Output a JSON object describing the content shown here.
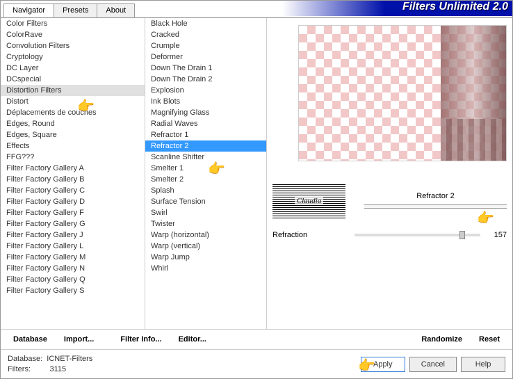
{
  "header": {
    "title": "Filters Unlimited 2.0"
  },
  "tabs": [
    {
      "label": "Navigator",
      "active": true
    },
    {
      "label": "Presets",
      "active": false
    },
    {
      "label": "About",
      "active": false
    }
  ],
  "categories": [
    "Color Filters",
    "ColorRave",
    "Convolution Filters",
    "Cryptology",
    "DC Layer",
    "DCspecial",
    "Distortion Filters",
    "Distort",
    "Déplacements de couches",
    "Edges, Round",
    "Edges, Square",
    "Effects",
    "FFG???",
    "Filter Factory Gallery A",
    "Filter Factory Gallery B",
    "Filter Factory Gallery C",
    "Filter Factory Gallery D",
    "Filter Factory Gallery F",
    "Filter Factory Gallery G",
    "Filter Factory Gallery J",
    "Filter Factory Gallery L",
    "Filter Factory Gallery M",
    "Filter Factory Gallery N",
    "Filter Factory Gallery Q",
    "Filter Factory Gallery S"
  ],
  "categories_highlighted_index": 6,
  "filters": [
    "Black Hole",
    "Cracked",
    "Crumple",
    "Deformer",
    "Down The Drain 1",
    "Down The Drain 2",
    "Explosion",
    "Ink Blots",
    "Magnifying Glass",
    "Radial Waves",
    "Refractor 1",
    "Refractor 2",
    "Scanline Shifter",
    "Smelter 1",
    "Smelter 2",
    "Splash",
    "Surface Tension",
    "Swirl",
    "Twister",
    "Warp (horizontal)",
    "Warp (vertical)",
    "Warp Jump",
    "Whirl"
  ],
  "filters_selected_index": 11,
  "toolbar": {
    "database": "Database",
    "import": "Import...",
    "filter_info": "Filter Info...",
    "editor": "Editor...",
    "randomize": "Randomize",
    "reset": "Reset"
  },
  "panel": {
    "selected_filter": "Refractor 2",
    "param_label": "Refraction",
    "param_value": "157"
  },
  "status": {
    "database_label": "Database:",
    "database_value": "ICNET-Filters",
    "filters_label": "Filters:",
    "filters_value": "3115"
  },
  "buttons": {
    "apply": "Apply",
    "cancel": "Cancel",
    "help": "Help"
  },
  "logo_text": "Claudia"
}
